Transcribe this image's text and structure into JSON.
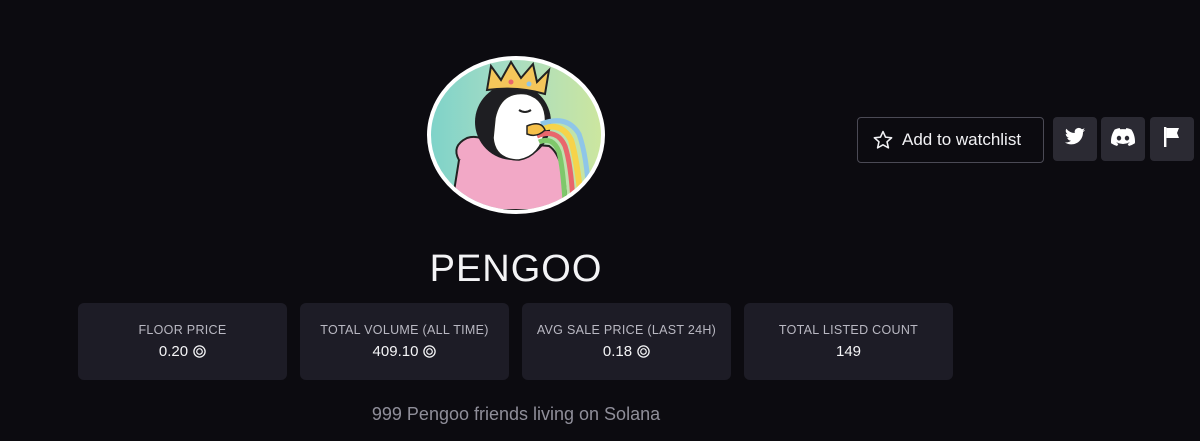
{
  "collection": {
    "name": "PENGOO",
    "description": "999 Pengoo friends living on Solana",
    "avatar": "pengoo-king-penguin-avatar"
  },
  "actions": {
    "watchlist_label": "Add to watchlist",
    "watchlist_icon": "star-icon",
    "social": [
      {
        "name": "twitter",
        "icon": "twitter-icon"
      },
      {
        "name": "discord",
        "icon": "discord-icon"
      },
      {
        "name": "report",
        "icon": "flag-icon"
      }
    ]
  },
  "stats": [
    {
      "label": "FLOOR PRICE",
      "value": "0.20",
      "currency_icon": "sol-icon"
    },
    {
      "label": "TOTAL VOLUME (ALL TIME)",
      "value": "409.10",
      "currency_icon": "sol-icon"
    },
    {
      "label": "AVG SALE PRICE (LAST 24H)",
      "value": "0.18",
      "currency_icon": "sol-icon"
    },
    {
      "label": "TOTAL LISTED COUNT",
      "value": "149",
      "currency_icon": ""
    }
  ],
  "colors": {
    "background": "#0c0b10",
    "card": "#1d1c26",
    "button": "#2b2a33"
  }
}
